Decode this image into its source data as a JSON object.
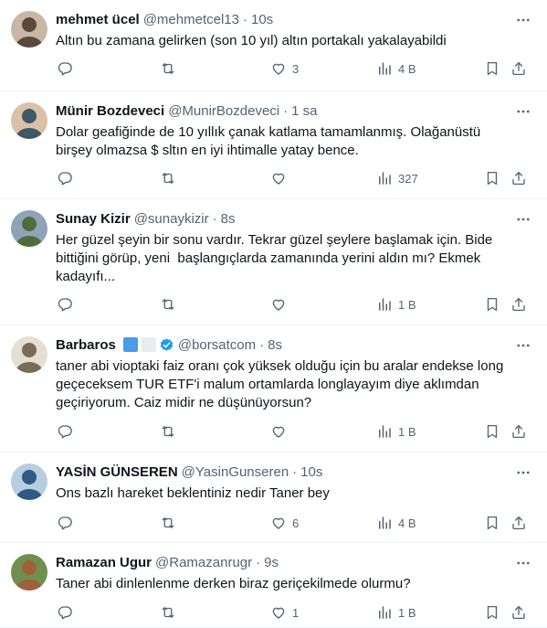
{
  "tweets": [
    {
      "name": "mehmet ücel",
      "handle": "@mehmetcel13",
      "dot": "·",
      "time": "10s",
      "text": "Altın bu zamana gelirken (son 10 yıl) altın portakalı yakalayabildi",
      "replies": "",
      "retweets": "",
      "likes": "3",
      "views": "4 B",
      "avatar_colors": [
        "#5b4a3c",
        "#c9b7a5"
      ]
    },
    {
      "name": "Münir Bozdeveci",
      "handle": "@MunirBozdeveci",
      "dot": "·",
      "time": "1 sa",
      "text": "Dolar geafiğinde de 10 yıllık çanak katlama tamamlanmış. Olağanüstü\nbirşey olmazsa $ sltın en iyi ihtimalle yatay bence.",
      "replies": "",
      "retweets": "",
      "likes": "",
      "views": "327",
      "avatar_colors": [
        "#3e5866",
        "#d9c1a8"
      ]
    },
    {
      "name": "Sunay Kizir",
      "handle": "@sunaykizir",
      "dot": "·",
      "time": "8s",
      "text": "Her güzel şeyin bir sonu vardır. Tekrar güzel şeylere başlamak için. Bide\nbittiğini görüp, yeni  başlangıçlarda zamanında yerini aldın mı? Ekmek\nkadayıfı...",
      "replies": "",
      "retweets": "",
      "likes": "",
      "views": "1 B",
      "avatar_colors": [
        "#4f6d3a",
        "#8fa3b8"
      ]
    },
    {
      "name": "Barbaros",
      "handle": "@borsatcom",
      "dot": "·",
      "time": "8s",
      "text": "taner abi vioptaki faiz oranı çok yüksek olduğu için bu aralar endekse long\ngeçeceksem TUR ETF'i malum ortamlarda longlayayım diye aklımdan\ngeçiriyorum. Caiz midir ne düşünüyorsun?",
      "replies": "",
      "retweets": "",
      "likes": "",
      "views": "1 B",
      "avatar_colors": [
        "#7a6a58",
        "#e5ded2"
      ],
      "badges": [
        "#4a9be8",
        "#e6ecf0"
      ],
      "verified_color": "#1d9bf0"
    },
    {
      "name": "YASİN GÜNSEREN",
      "handle": "@YasinGunseren",
      "dot": "·",
      "time": "10s",
      "text": "Ons bazlı hareket beklentiniz nedir Taner bey",
      "replies": "",
      "retweets": "",
      "likes": "6",
      "views": "4 B",
      "avatar_colors": [
        "#2f5a86",
        "#b9cde0"
      ]
    },
    {
      "name": "Ramazan Ugur",
      "handle": "@Ramazanrugr",
      "dot": "·",
      "time": "9s",
      "text": "Taner abi dinlenlenme derken biraz geriçekilmede olurmu?",
      "replies": "",
      "retweets": "",
      "likes": "1",
      "views": "1 B",
      "avatar_colors": [
        "#a0603c",
        "#6f8f4e"
      ]
    }
  ],
  "colors": {
    "text_primary": "#0f1419",
    "text_secondary": "#536471",
    "divider": "#eff3f4"
  },
  "icons": {
    "reply": "reply-icon",
    "retweet": "retweet-icon",
    "like": "heart-icon",
    "views": "views-icon",
    "bookmark": "bookmark-icon",
    "share": "share-icon",
    "more": "more-icon"
  }
}
